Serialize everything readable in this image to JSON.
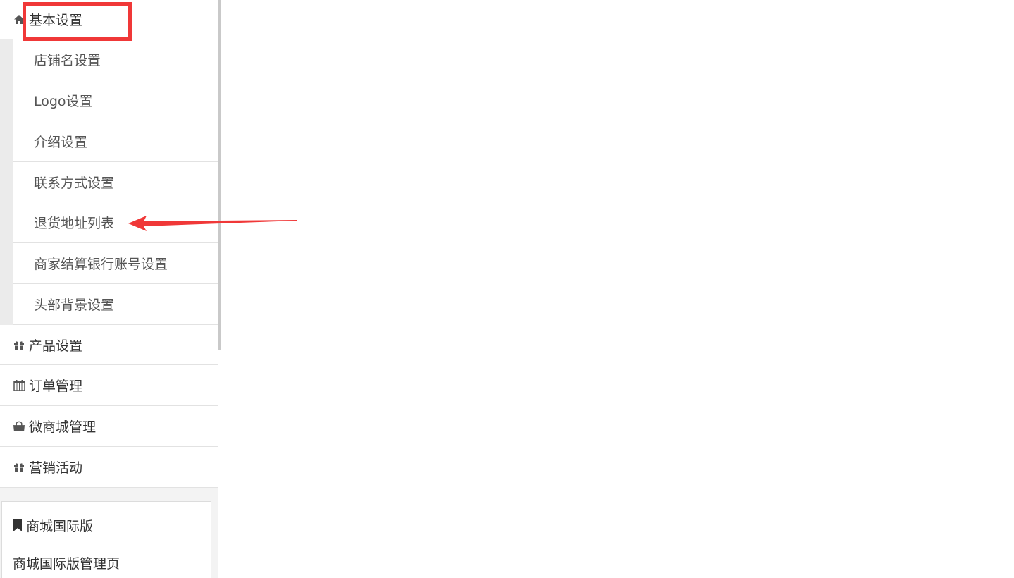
{
  "sidebar": {
    "basic_settings": {
      "label": "基本设置",
      "icon": "home-icon"
    },
    "basic_submenu": [
      {
        "label": "店铺名设置"
      },
      {
        "label": "Logo设置"
      },
      {
        "label": "介绍设置"
      },
      {
        "label": "联系方式设置"
      },
      {
        "label": "退货地址列表"
      },
      {
        "label": "商家结算银行账号设置"
      },
      {
        "label": "头部背景设置"
      }
    ],
    "product_settings": {
      "label": "产品设置",
      "icon": "gift-icon"
    },
    "order_management": {
      "label": "订单管理",
      "icon": "calendar-icon"
    },
    "wechat_mall_management": {
      "label": "微商城管理",
      "icon": "shopping-bag-icon"
    },
    "marketing": {
      "label": "营销活动",
      "icon": "gift-icon"
    }
  },
  "panel": {
    "title": "商城国际版",
    "title_icon": "bookmark-icon",
    "link": "商城国际版管理页"
  },
  "colors": {
    "annotation_red": "#f03838",
    "border": "#e2e2e2",
    "submenu_bg": "#ebebeb"
  }
}
